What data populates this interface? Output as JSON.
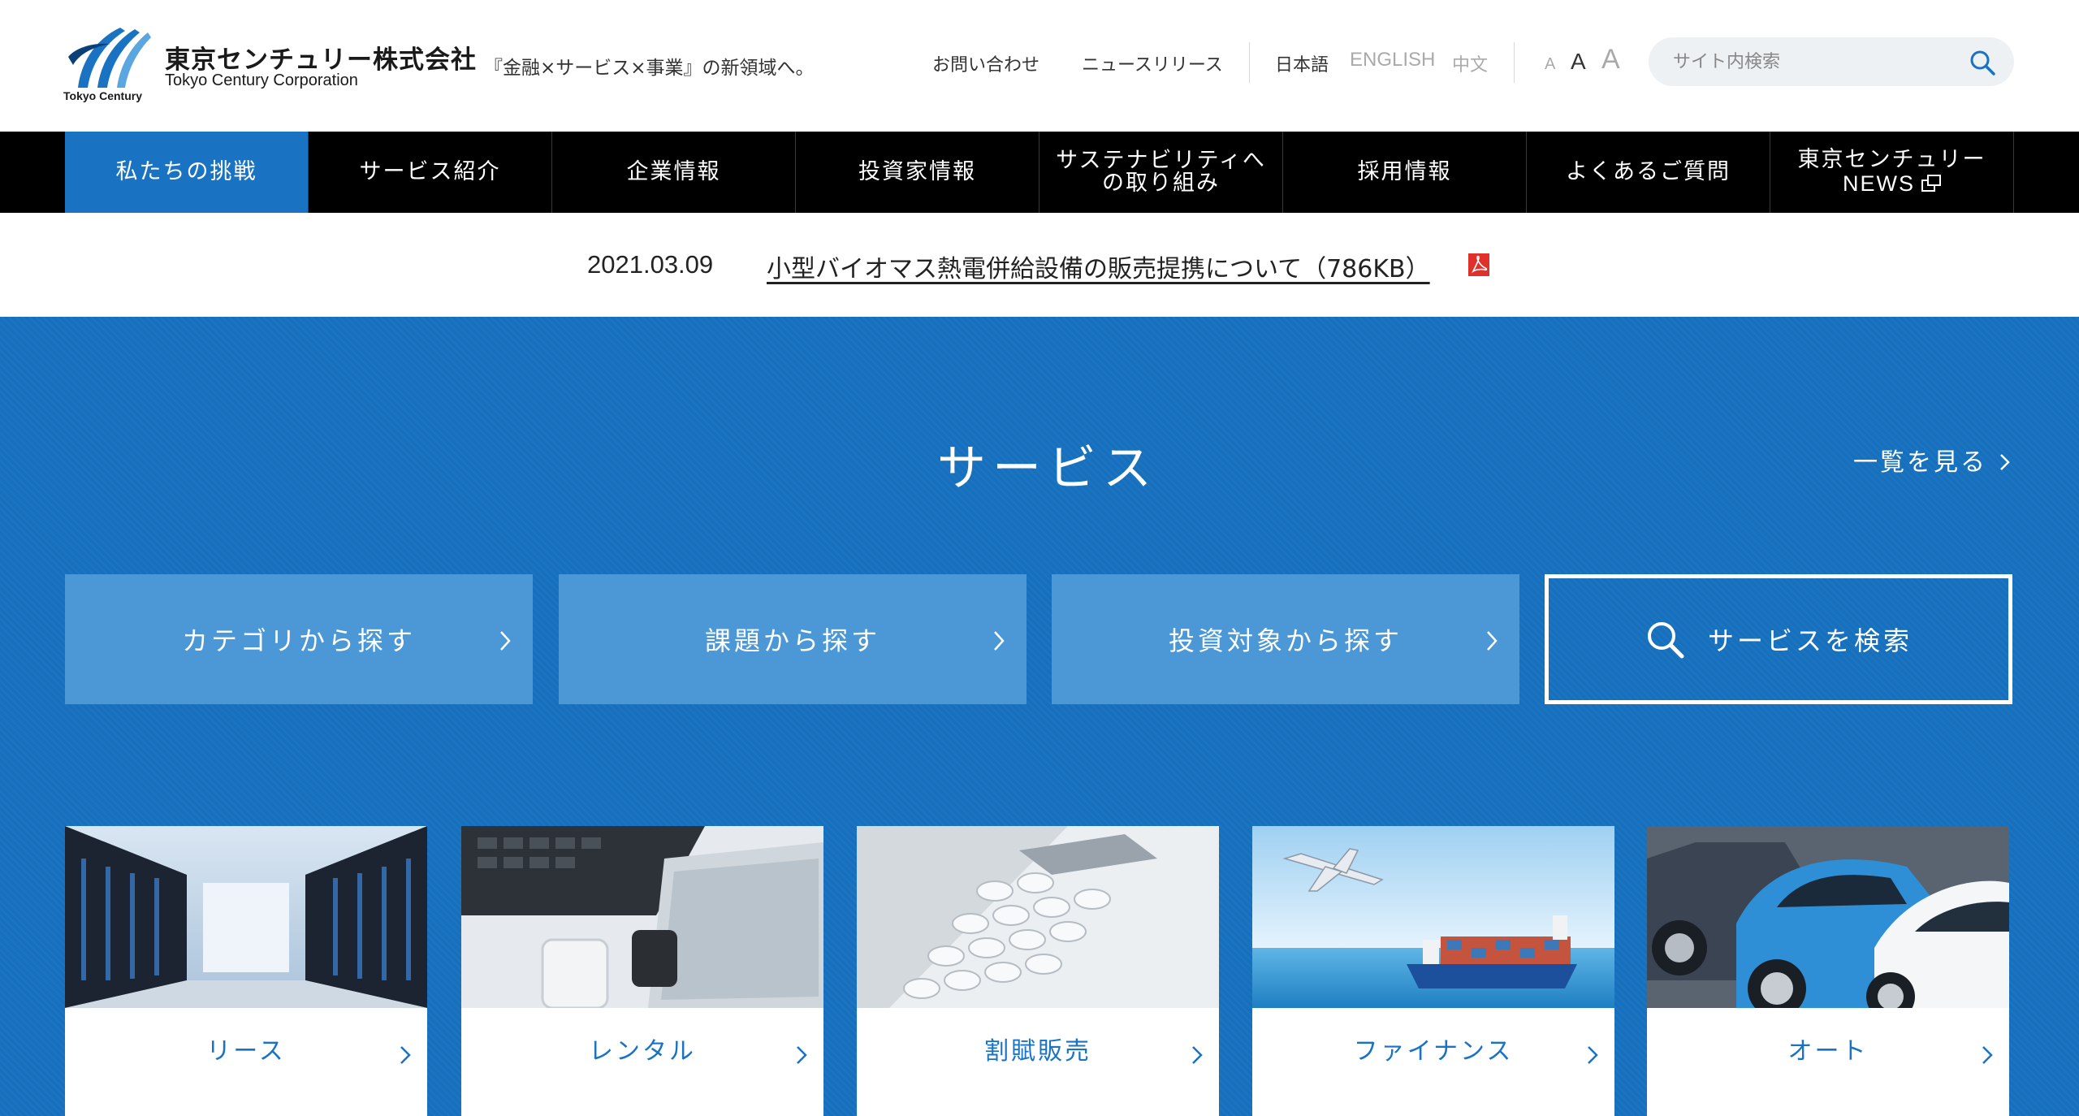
{
  "header": {
    "company_ja": "東京センチュリー株式会社",
    "company_en": "Tokyo Century Corporation",
    "logo_text": "Tokyo Century",
    "tagline": "『金融×サービス×事業』の新領域へ。",
    "links": {
      "contact": "お問い合わせ",
      "news_release": "ニュースリリース"
    },
    "languages": {
      "ja": "日本語",
      "en": "ENGLISH",
      "zh": "中文"
    },
    "font_size": {
      "small": "A",
      "medium": "A",
      "large": "A"
    },
    "search": {
      "placeholder": "サイト内検索"
    }
  },
  "nav": {
    "items": [
      {
        "label": "私たちの挑戦"
      },
      {
        "label": "サービス紹介"
      },
      {
        "label": "企業情報"
      },
      {
        "label": "投資家情報"
      },
      {
        "label": "サステナビリティへ",
        "label2": "の取り組み"
      },
      {
        "label": "採用情報"
      },
      {
        "label": "よくあるご質問"
      },
      {
        "label": "東京センチュリー",
        "label2": "NEWS"
      }
    ]
  },
  "news": {
    "date": "2021.03.09",
    "title": "小型バイオマス熱電併給設備の販売提携について（786KB）"
  },
  "service": {
    "title": "サービス",
    "see_all": "一覧を見る",
    "buttons": {
      "category": "カテゴリから探す",
      "issue": "課題から探す",
      "investment": "投資対象から探す",
      "search": "サービスを検索"
    },
    "cards": [
      {
        "label": "リース"
      },
      {
        "label": "レンタル"
      },
      {
        "label": "割賦販売"
      },
      {
        "label": "ファイナンス"
      },
      {
        "label": "オート"
      }
    ]
  },
  "colors": {
    "brand_blue": "#1a73c2",
    "section_blue": "#1670bd",
    "button_blue": "#4c98d6",
    "nav_black": "#000000"
  }
}
